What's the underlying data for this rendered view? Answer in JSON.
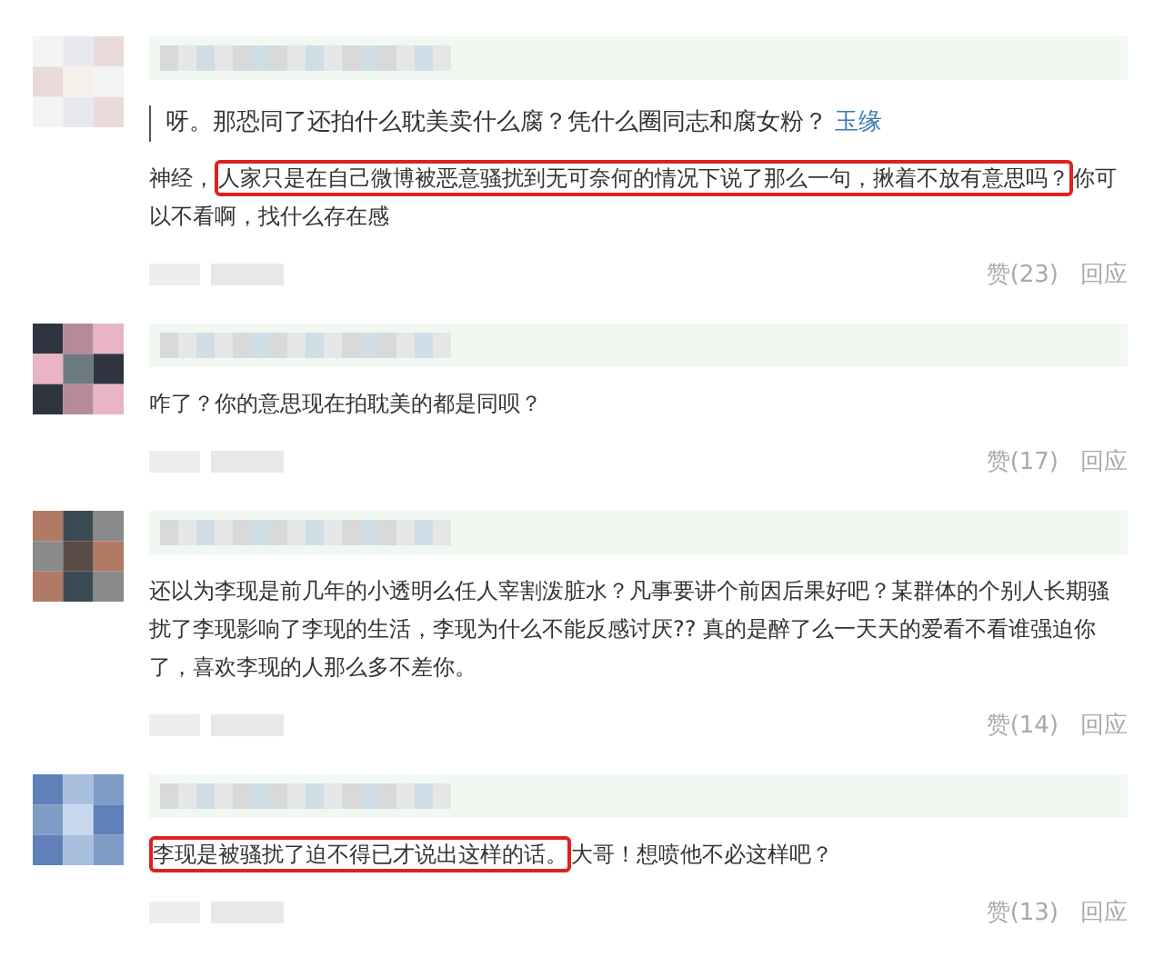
{
  "comments": [
    {
      "quote": {
        "text": "呀。那恐同了还拍什么耽美卖什么腐？凭什么圈同志和腐女粉？",
        "link": "玉缘"
      },
      "segments": [
        {
          "text": "神经，",
          "highlighted": false
        },
        {
          "text": "人家只是在自己微博被恶意骚扰到无可奈何的情况下说了那么一句，揪着不放有意思吗？",
          "highlighted": true
        },
        {
          "text": "你可以不看啊，找什么存在感",
          "highlighted": false
        }
      ],
      "likes": "赞(23)",
      "reply": "回应"
    },
    {
      "segments": [
        {
          "text": "咋了？你的意思现在拍耽美的都是同呗？",
          "highlighted": false
        }
      ],
      "likes": "赞(17)",
      "reply": "回应"
    },
    {
      "segments": [
        {
          "text": "还以为李现是前几年的小透明么任人宰割泼脏水？凡事要讲个前因后果好吧？某群体的个别人长期骚扰了李现影响了李现的生活，李现为什么不能反感讨厌?? 真的是醉了么一天天的爱看不看谁强迫你了，喜欢李现的人那么多不差你。",
          "highlighted": false
        }
      ],
      "likes": "赞(14)",
      "reply": "回应"
    },
    {
      "segments": [
        {
          "text": "李现是被骚扰了迫不得已才说出这样的话。",
          "highlighted": true
        },
        {
          "text": "大哥！想喷他不必这样吧？",
          "highlighted": false
        }
      ],
      "likes": "赞(13)",
      "reply": "回应"
    }
  ]
}
